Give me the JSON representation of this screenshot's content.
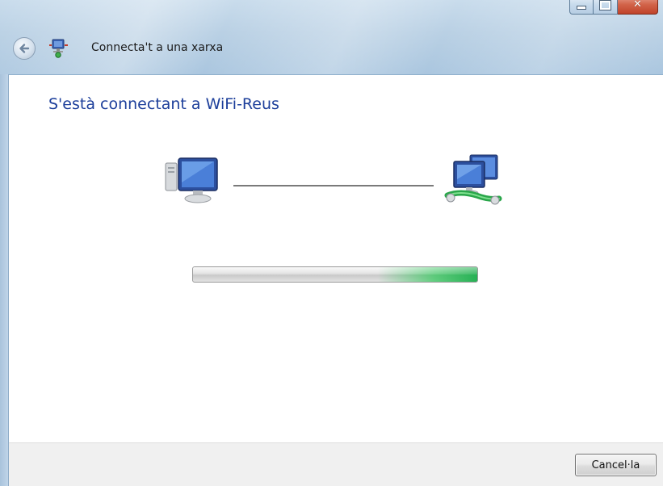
{
  "window": {
    "title": "Connecta't a una xarxa",
    "caption_buttons": [
      "minimize-icon",
      "maximize-icon",
      "close-icon"
    ]
  },
  "content": {
    "heading": "S'està connectant a WiFi-Reus",
    "icons": [
      "computer-icon",
      "network-icon"
    ],
    "progress": {
      "style": "marquee",
      "indicator_position_fraction": 1.0,
      "accent_color": "#27b155"
    },
    "heading_color": "#1d3f9b"
  },
  "footer": {
    "cancel_label": "Cancel·la"
  }
}
